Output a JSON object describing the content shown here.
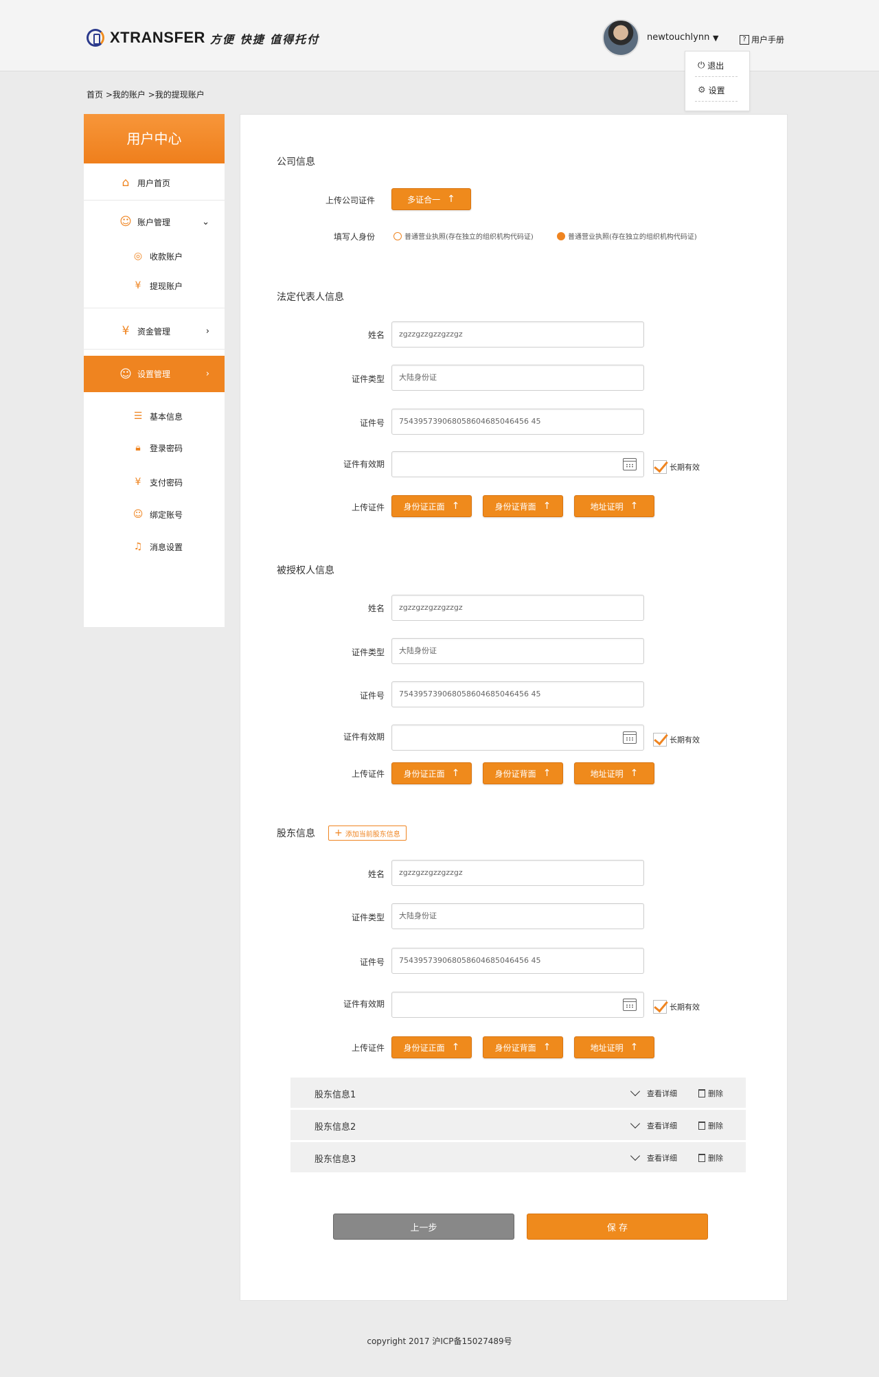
{
  "header": {
    "brand": "XTRANSFER",
    "slogan": "方便 快捷 值得托付",
    "username": "newtouchlynn",
    "manual": "用户手册",
    "dropdown": {
      "logout": "退出",
      "settings": "设置"
    }
  },
  "breadcrumb": "首页 >我的账户 >我的提现账户",
  "sidebar": {
    "title": "用户中心",
    "items": [
      {
        "label": "用户首页"
      },
      {
        "label": "账户管理"
      },
      {
        "label": "收款账户"
      },
      {
        "label": "提现账户"
      },
      {
        "label": "资金管理"
      },
      {
        "label": "设置管理"
      },
      {
        "label": "基本信息"
      },
      {
        "label": "登录密码"
      },
      {
        "label": "支付密码"
      },
      {
        "label": "绑定账号"
      },
      {
        "label": "消息设置"
      }
    ]
  },
  "company": {
    "title": "公司信息",
    "upload_label": "上传公司证件",
    "upload_btn": "多证合一",
    "identity_label": "填写人身份",
    "option1": "普通营业执照(存在独立的组织机构代码证)",
    "option2": "普通营业执照(存在独立的组织机构代码证)"
  },
  "labels": {
    "name": "姓名",
    "id_type": "证件类型",
    "id_no": "证件号",
    "validity": "证件有效期",
    "long_term": "长期有效",
    "upload": "上传证件",
    "front": "身份证正面",
    "back": "身份证背面",
    "address": "地址证明"
  },
  "legal": {
    "title": "法定代表人信息",
    "name": "zgzzgzzgzzgzzgz",
    "id_type": "大陆身份证",
    "id_no": "754395739068058604685046456 45"
  },
  "authorized": {
    "title": "被授权人信息",
    "name": "zgzzgzzgzzgzzgz",
    "id_type": "大陆身份证",
    "id_no": "754395739068058604685046456 45"
  },
  "shareholder": {
    "title": "股东信息",
    "add": "添加当前股东信息",
    "name": "zgzzgzzgzzgzzgz",
    "id_type": "大陆身份证",
    "id_no": "754395739068058604685046456 45",
    "rows": [
      {
        "name": "股东信息1"
      },
      {
        "name": "股东信息2"
      },
      {
        "name": "股东信息3"
      }
    ],
    "view": "查看详细",
    "delete": "删除"
  },
  "actions": {
    "prev": "上一步",
    "save": "保 存"
  },
  "footer": "copyright 2017    沪ICP备15027489号",
  "colors": {
    "accent": "#ef8420",
    "secondary_button": "#888888"
  }
}
